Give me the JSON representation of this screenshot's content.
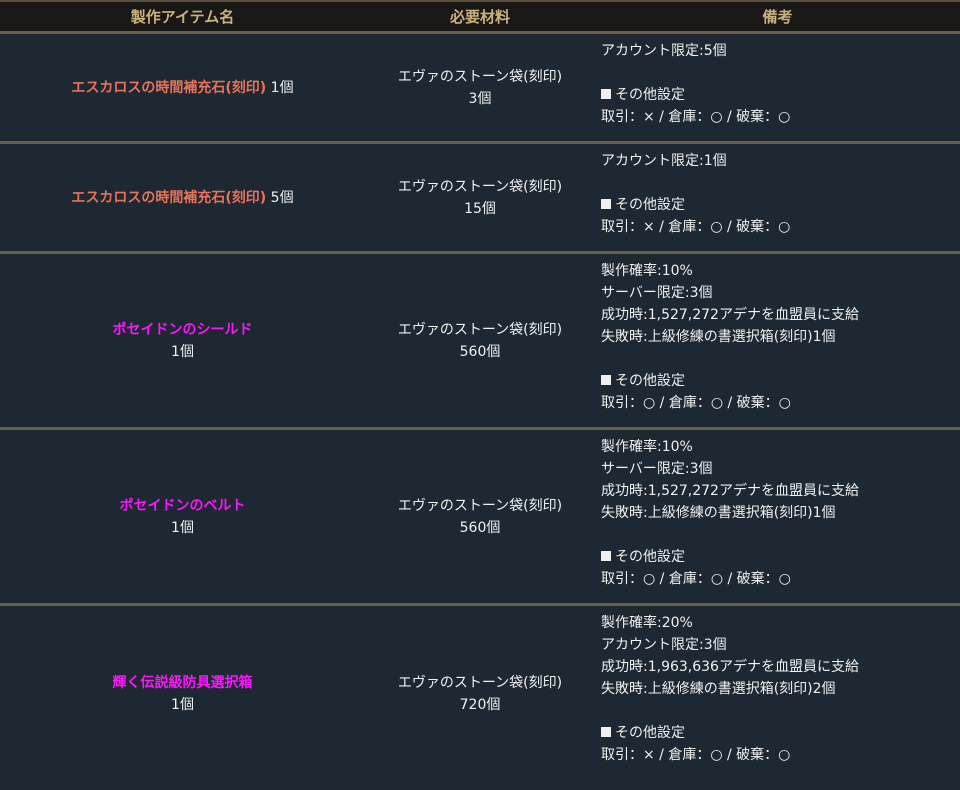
{
  "colors": {
    "header_bg": "#1a1717",
    "header_text": "#c9b27e",
    "row_bg": "#1e2832",
    "separator": "#6b5d48",
    "text": "#f0f0f0",
    "item_orange": "#e6735a",
    "item_magenta": "#ff14ff"
  },
  "headers": {
    "item": "製作アイテム名",
    "materials": "必要材料",
    "notes": "備考"
  },
  "rows": [
    {
      "item_name": "エスカロスの時間補充石(刻印)",
      "item_color": "#e6735a",
      "item_qty": "1個",
      "qty_inline": true,
      "material_name": "エヴァのストーン袋(刻印)",
      "material_qty": "3個",
      "notes_before": [
        "アカウント限定:5個",
        ""
      ],
      "other_heading": "その他設定",
      "trade_line": "取引：× / 倉庫：○ / 破棄：○"
    },
    {
      "item_name": "エスカロスの時間補充石(刻印)",
      "item_color": "#e6735a",
      "item_qty": "5個",
      "qty_inline": true,
      "material_name": "エヴァのストーン袋(刻印)",
      "material_qty": "15個",
      "notes_before": [
        "アカウント限定:1個",
        ""
      ],
      "other_heading": "その他設定",
      "trade_line": "取引：× / 倉庫：○ / 破棄：○"
    },
    {
      "item_name": "ポセイドンのシールド",
      "item_color": "#ff14ff",
      "item_qty": "1個",
      "qty_inline": false,
      "material_name": "エヴァのストーン袋(刻印)",
      "material_qty": "560個",
      "notes_before": [
        "製作確率:10%",
        "サーバー限定:3個",
        "成功時:1,527,272アデナを血盟員に支給",
        "失敗時:上級修練の書選択箱(刻印)1個",
        ""
      ],
      "other_heading": "その他設定",
      "trade_line": "取引：○ / 倉庫：○ / 破棄：○"
    },
    {
      "item_name": "ポセイドンのベルト",
      "item_color": "#ff14ff",
      "item_qty": "1個",
      "qty_inline": false,
      "material_name": "エヴァのストーン袋(刻印)",
      "material_qty": "560個",
      "notes_before": [
        "製作確率:10%",
        "サーバー限定:3個",
        "成功時:1,527,272アデナを血盟員に支給",
        "失敗時:上級修練の書選択箱(刻印)1個",
        ""
      ],
      "other_heading": "その他設定",
      "trade_line": "取引：○ / 倉庫：○ / 破棄：○"
    },
    {
      "item_name": "輝く伝説級防具選択箱",
      "item_color": "#ff14ff",
      "item_qty": "1個",
      "qty_inline": false,
      "material_name": "エヴァのストーン袋(刻印)",
      "material_qty": "720個",
      "notes_before": [
        "製作確率:20%",
        "アカウント限定:3個",
        "成功時:1,963,636アデナを血盟員に支給",
        "失敗時:上級修練の書選択箱(刻印)2個",
        ""
      ],
      "other_heading": "その他設定",
      "trade_line": "取引：× / 倉庫：○ / 破棄：○"
    }
  ]
}
